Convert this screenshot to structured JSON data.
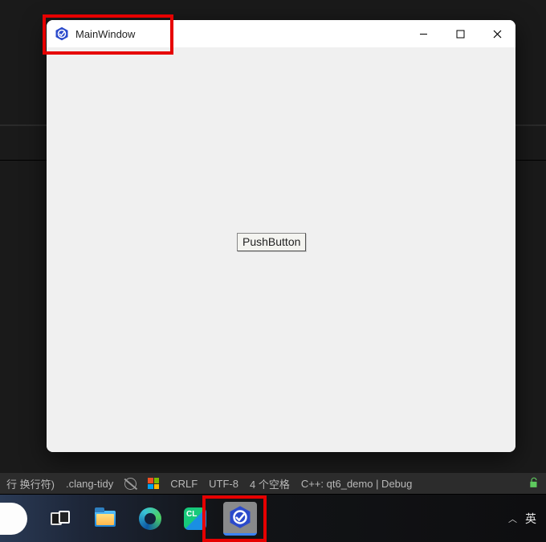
{
  "window": {
    "title": "MainWindow",
    "button_label": "PushButton"
  },
  "ide_status": {
    "left1": "行 换行符)",
    "clang": ".clang-tidy",
    "crlf": "CRLF",
    "utf8": "UTF-8",
    "spaces": "4 个空格",
    "config": "C++: qt6_demo | Debug"
  },
  "taskbar": {
    "ime": "英"
  }
}
